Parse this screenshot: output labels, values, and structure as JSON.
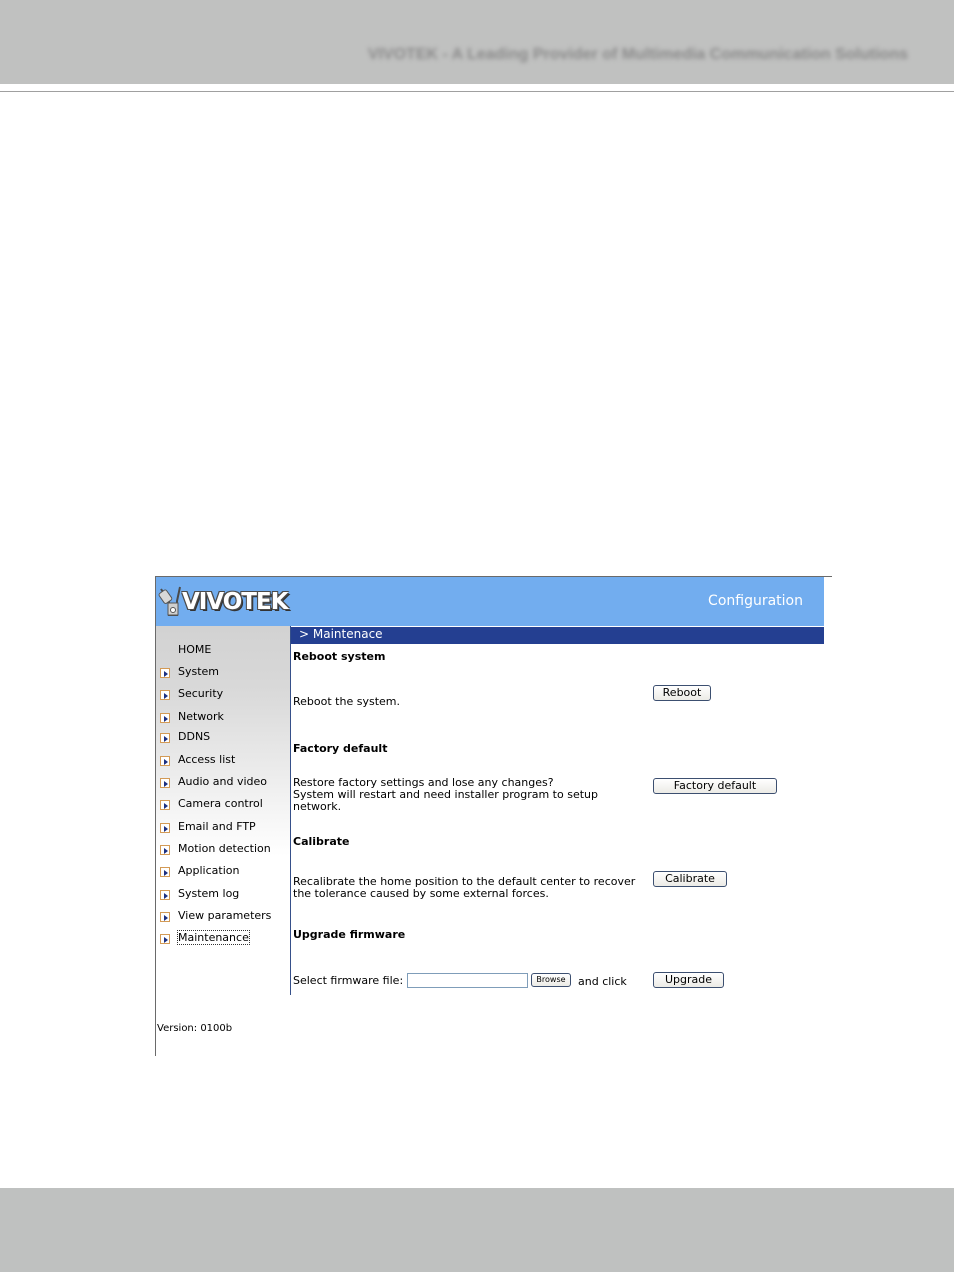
{
  "page": {
    "header_text": "VIVOTEK - A Leading Provider of Multimedia Communication Solutions"
  },
  "app": {
    "logo_text": "VIVOTEK",
    "banner_title": "Configuration",
    "breadcrumb": "> Maintenace",
    "version": "Version: 0100b"
  },
  "sidebar": {
    "items": [
      {
        "label": "HOME",
        "arrow": false
      },
      {
        "label": "System",
        "arrow": true
      },
      {
        "label": "Security",
        "arrow": true
      },
      {
        "label": "Network",
        "arrow": true
      },
      {
        "label": "DDNS",
        "arrow": true
      },
      {
        "label": "Access list",
        "arrow": true
      },
      {
        "label": "Audio and video",
        "arrow": true
      },
      {
        "label": "Camera control",
        "arrow": true
      },
      {
        "label": "Email and FTP",
        "arrow": true
      },
      {
        "label": "Motion detection",
        "arrow": true
      },
      {
        "label": "Application",
        "arrow": true
      },
      {
        "label": "System log",
        "arrow": true
      },
      {
        "label": "View parameters",
        "arrow": true
      },
      {
        "label": "Maintenance",
        "arrow": true,
        "active": true
      }
    ]
  },
  "sections": {
    "reboot": {
      "title": "Reboot system",
      "desc": "Reboot the system.",
      "button": "Reboot"
    },
    "factory": {
      "title": "Factory default",
      "desc_line1": "Restore factory settings and lose any changes?",
      "desc_line2": "System will restart and need installer program to setup",
      "desc_line3": "network.",
      "button": "Factory default"
    },
    "calibrate": {
      "title": "Calibrate",
      "desc_line1": "Recalibrate the home position to the default center to recover",
      "desc_line2": "the tolerance caused by some external forces.",
      "button": "Calibrate"
    },
    "upgrade": {
      "title": "Upgrade firmware",
      "file_label": "Select firmware file:",
      "file_value": "",
      "browse_button": "Browse",
      "and_click": "and click",
      "button": "Upgrade"
    }
  }
}
